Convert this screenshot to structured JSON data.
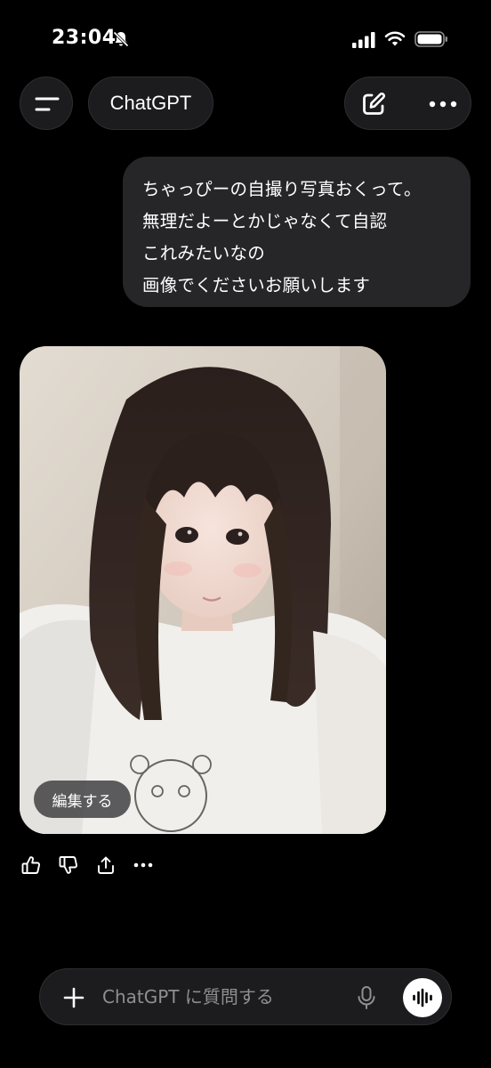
{
  "status_bar": {
    "time": "23:04",
    "icons": [
      "bell-slash-icon",
      "cellular-signal-icon",
      "wifi-icon",
      "battery-icon"
    ]
  },
  "header": {
    "menu_icon": "menu-icon",
    "title": "ChatGPT",
    "new_chat_icon": "edit-icon",
    "more_icon": "more-icon"
  },
  "conversation": {
    "user_message": {
      "lines": [
        "ちゃっぴーの自撮り写真おくって。",
        "無理だよーとかじゃなくて自認",
        "これみたいなの",
        "画像でくださいお願いします"
      ]
    },
    "assistant_image": {
      "edit_label": "編集する"
    },
    "actions": [
      "thumbs-up-icon",
      "thumbs-down-icon",
      "share-icon",
      "more-icon"
    ]
  },
  "composer": {
    "placeholder": "ChatGPT に質問する",
    "icons": [
      "plus-icon",
      "mic-icon",
      "voice-mode-icon"
    ]
  },
  "colors": {
    "background": "#000000",
    "surface": "#1c1c1e",
    "bubble": "#262628",
    "placeholder": "#8e8e93"
  }
}
